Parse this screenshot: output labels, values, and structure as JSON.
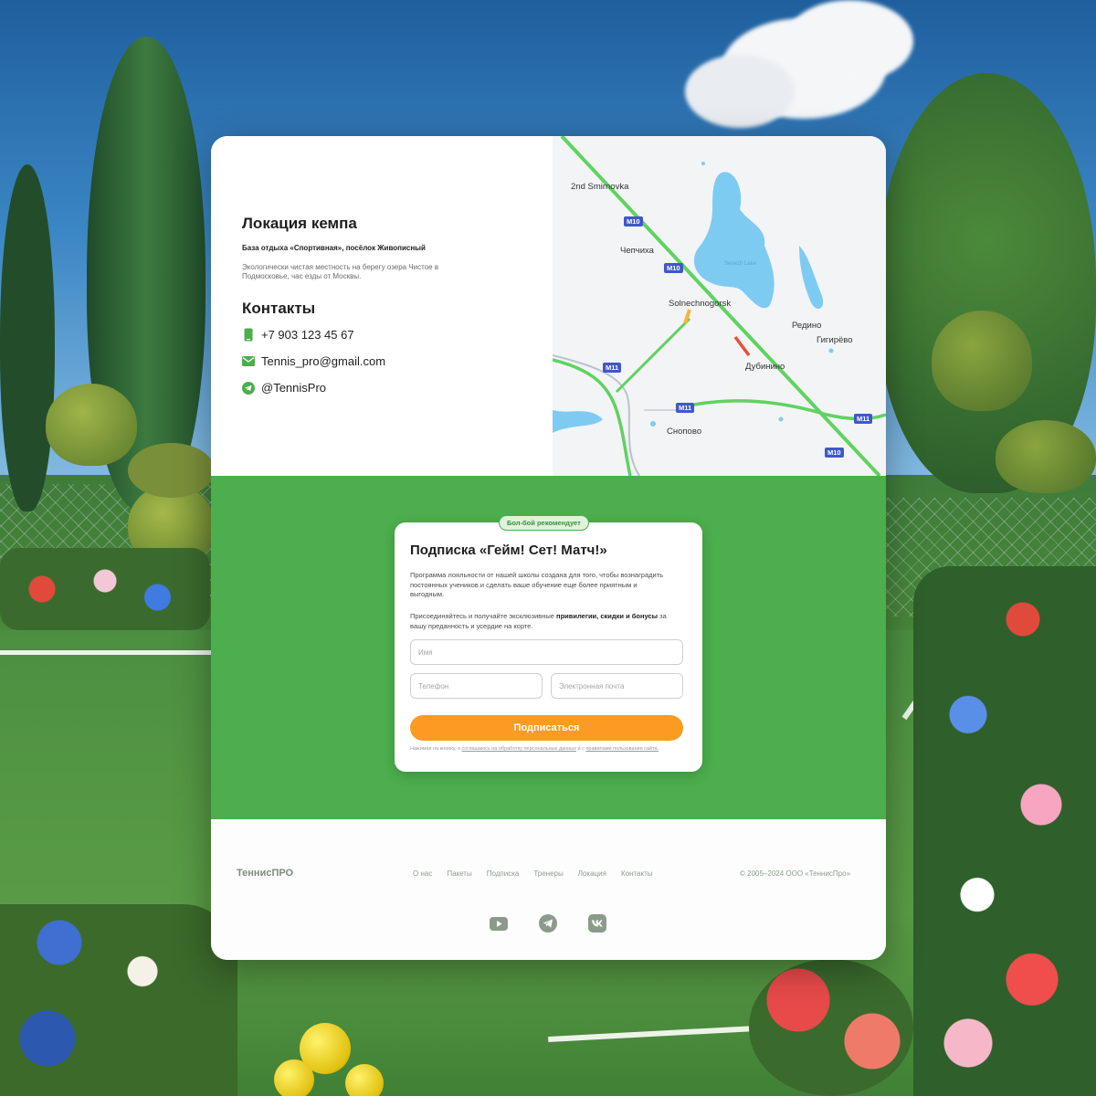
{
  "location": {
    "title": "Локация кемпа",
    "subtitle": "База отдыха «Спортивная», посёлок Живописный",
    "description": "Экологически чистая местность на берегу озера Чистое в Подмосковье, час езды от Москвы."
  },
  "contacts": {
    "title": "Контакты",
    "phone": "+7 903 123 45 67",
    "email": "Tennis_pro@gmail.com",
    "telegram": "@TennisPro",
    "phone_icon": "phone-icon",
    "email_icon": "mail-icon",
    "telegram_icon": "telegram-icon"
  },
  "map": {
    "labels": {
      "smirnovka": "2nd Smirnovka",
      "chepchikha": "Чепчиха",
      "solnechnogorsk": "Solnechnogorsk",
      "redino": "Редино",
      "gigiryovo": "Гигирёво",
      "dubinino": "Дубинино",
      "snopovo": "Сноповo",
      "lake": "Senezh Lake"
    },
    "roads": {
      "m10": "M10",
      "m11": "M11"
    }
  },
  "subscription": {
    "badge": "Бол-бой рекомендует",
    "title": "Подписка «Гейм! Сет! Матч!»",
    "paragraph1": "Программа лояльности от нашей школы создана для того, чтобы вознаградить постоянных учеников и сделать ваше обучение еще более приятным и выгодным.",
    "paragraph2_start": "Присоединяйтесь и получайте эксклюзивные ",
    "paragraph2_bold": "привилегии, скидки и бонусы",
    "paragraph2_end": " за вашу преданность и усердие на корте.",
    "name_placeholder": "Имя",
    "phone_placeholder": "Телефон",
    "email_placeholder": "Электронная почта",
    "submit_label": "Подписаться",
    "legal_start": "Нажимая на кнопку, я ",
    "legal_link1": "соглашаюсь на обработку персональных данных",
    "legal_mid": " и с ",
    "legal_link2": "правилами пользования сайта."
  },
  "footer": {
    "brand": "ТеннисПРО",
    "nav": [
      "О нас",
      "Пакеты",
      "Подписка",
      "Тренеры",
      "Локация",
      "Контакты"
    ],
    "copyright": "© 2005–2024 ООО «ТеннисПро»",
    "socials": [
      "youtube-icon",
      "telegram-icon",
      "vk-icon"
    ]
  },
  "colors": {
    "brand_green": "#4cae4c",
    "accent_orange": "#fb9b22",
    "road_badge": "#3f59c9"
  }
}
